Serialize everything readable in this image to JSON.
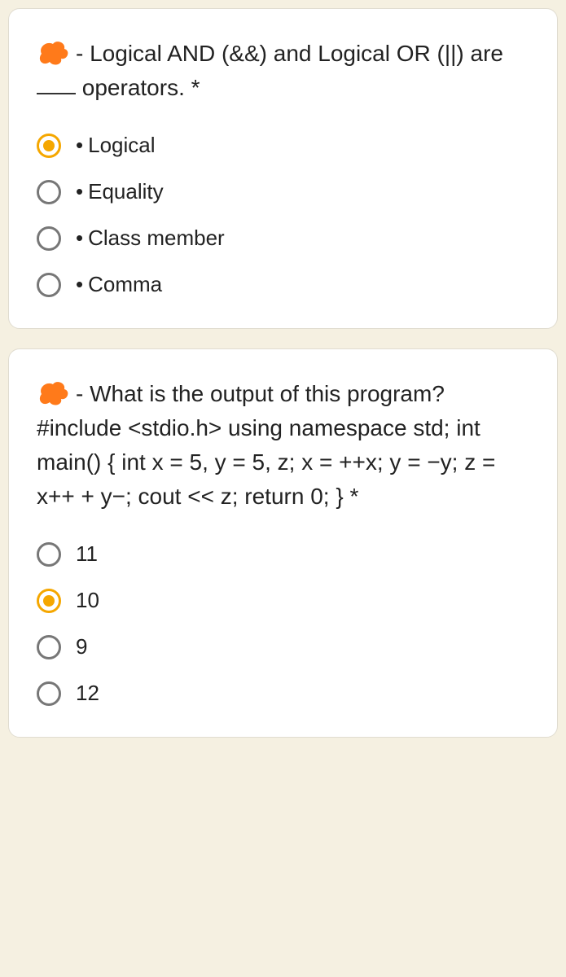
{
  "questions": [
    {
      "prefix": "-",
      "part1": "Logical AND (&&) and Logical OR (||) are ",
      "part2": " operators. *",
      "options": [
        {
          "label": "Logical",
          "bullet": true,
          "selected": true
        },
        {
          "label": "Equality",
          "bullet": true,
          "selected": false
        },
        {
          "label": "Class member",
          "bullet": true,
          "selected": false
        },
        {
          "label": "Comma",
          "bullet": true,
          "selected": false
        }
      ]
    },
    {
      "prefix": "-",
      "text": "What is the output of this program? #include <stdio.h> using namespace std; int main() { int x = 5, y = 5, z; x = ++x; y = −y; z = x++ + y−; cout << z; return 0; } *",
      "options": [
        {
          "label": "11",
          "bullet": false,
          "selected": false
        },
        {
          "label": "10",
          "bullet": false,
          "selected": true
        },
        {
          "label": "9",
          "bullet": false,
          "selected": false
        },
        {
          "label": "12",
          "bullet": false,
          "selected": false
        }
      ]
    }
  ]
}
